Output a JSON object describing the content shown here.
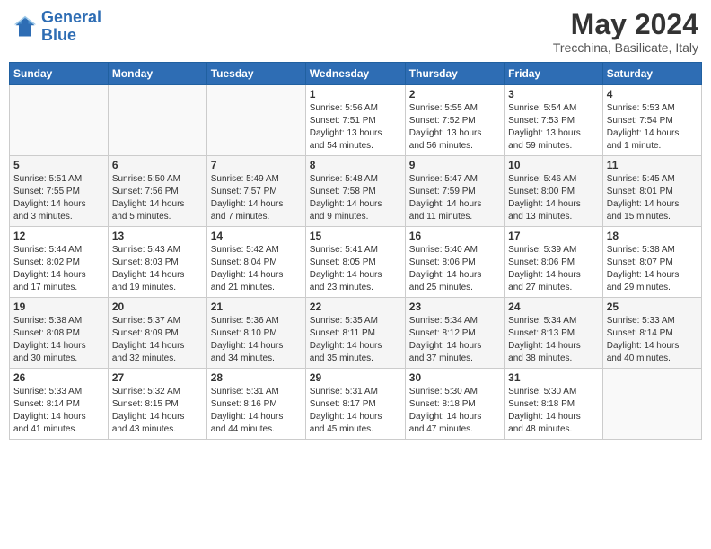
{
  "header": {
    "logo_line1": "General",
    "logo_line2": "Blue",
    "month_year": "May 2024",
    "location": "Trecchina, Basilicate, Italy"
  },
  "days_of_week": [
    "Sunday",
    "Monday",
    "Tuesday",
    "Wednesday",
    "Thursday",
    "Friday",
    "Saturday"
  ],
  "weeks": [
    [
      {
        "day": "",
        "info": ""
      },
      {
        "day": "",
        "info": ""
      },
      {
        "day": "",
        "info": ""
      },
      {
        "day": "1",
        "info": "Sunrise: 5:56 AM\nSunset: 7:51 PM\nDaylight: 13 hours\nand 54 minutes."
      },
      {
        "day": "2",
        "info": "Sunrise: 5:55 AM\nSunset: 7:52 PM\nDaylight: 13 hours\nand 56 minutes."
      },
      {
        "day": "3",
        "info": "Sunrise: 5:54 AM\nSunset: 7:53 PM\nDaylight: 13 hours\nand 59 minutes."
      },
      {
        "day": "4",
        "info": "Sunrise: 5:53 AM\nSunset: 7:54 PM\nDaylight: 14 hours\nand 1 minute."
      }
    ],
    [
      {
        "day": "5",
        "info": "Sunrise: 5:51 AM\nSunset: 7:55 PM\nDaylight: 14 hours\nand 3 minutes."
      },
      {
        "day": "6",
        "info": "Sunrise: 5:50 AM\nSunset: 7:56 PM\nDaylight: 14 hours\nand 5 minutes."
      },
      {
        "day": "7",
        "info": "Sunrise: 5:49 AM\nSunset: 7:57 PM\nDaylight: 14 hours\nand 7 minutes."
      },
      {
        "day": "8",
        "info": "Sunrise: 5:48 AM\nSunset: 7:58 PM\nDaylight: 14 hours\nand 9 minutes."
      },
      {
        "day": "9",
        "info": "Sunrise: 5:47 AM\nSunset: 7:59 PM\nDaylight: 14 hours\nand 11 minutes."
      },
      {
        "day": "10",
        "info": "Sunrise: 5:46 AM\nSunset: 8:00 PM\nDaylight: 14 hours\nand 13 minutes."
      },
      {
        "day": "11",
        "info": "Sunrise: 5:45 AM\nSunset: 8:01 PM\nDaylight: 14 hours\nand 15 minutes."
      }
    ],
    [
      {
        "day": "12",
        "info": "Sunrise: 5:44 AM\nSunset: 8:02 PM\nDaylight: 14 hours\nand 17 minutes."
      },
      {
        "day": "13",
        "info": "Sunrise: 5:43 AM\nSunset: 8:03 PM\nDaylight: 14 hours\nand 19 minutes."
      },
      {
        "day": "14",
        "info": "Sunrise: 5:42 AM\nSunset: 8:04 PM\nDaylight: 14 hours\nand 21 minutes."
      },
      {
        "day": "15",
        "info": "Sunrise: 5:41 AM\nSunset: 8:05 PM\nDaylight: 14 hours\nand 23 minutes."
      },
      {
        "day": "16",
        "info": "Sunrise: 5:40 AM\nSunset: 8:06 PM\nDaylight: 14 hours\nand 25 minutes."
      },
      {
        "day": "17",
        "info": "Sunrise: 5:39 AM\nSunset: 8:06 PM\nDaylight: 14 hours\nand 27 minutes."
      },
      {
        "day": "18",
        "info": "Sunrise: 5:38 AM\nSunset: 8:07 PM\nDaylight: 14 hours\nand 29 minutes."
      }
    ],
    [
      {
        "day": "19",
        "info": "Sunrise: 5:38 AM\nSunset: 8:08 PM\nDaylight: 14 hours\nand 30 minutes."
      },
      {
        "day": "20",
        "info": "Sunrise: 5:37 AM\nSunset: 8:09 PM\nDaylight: 14 hours\nand 32 minutes."
      },
      {
        "day": "21",
        "info": "Sunrise: 5:36 AM\nSunset: 8:10 PM\nDaylight: 14 hours\nand 34 minutes."
      },
      {
        "day": "22",
        "info": "Sunrise: 5:35 AM\nSunset: 8:11 PM\nDaylight: 14 hours\nand 35 minutes."
      },
      {
        "day": "23",
        "info": "Sunrise: 5:34 AM\nSunset: 8:12 PM\nDaylight: 14 hours\nand 37 minutes."
      },
      {
        "day": "24",
        "info": "Sunrise: 5:34 AM\nSunset: 8:13 PM\nDaylight: 14 hours\nand 38 minutes."
      },
      {
        "day": "25",
        "info": "Sunrise: 5:33 AM\nSunset: 8:14 PM\nDaylight: 14 hours\nand 40 minutes."
      }
    ],
    [
      {
        "day": "26",
        "info": "Sunrise: 5:33 AM\nSunset: 8:14 PM\nDaylight: 14 hours\nand 41 minutes."
      },
      {
        "day": "27",
        "info": "Sunrise: 5:32 AM\nSunset: 8:15 PM\nDaylight: 14 hours\nand 43 minutes."
      },
      {
        "day": "28",
        "info": "Sunrise: 5:31 AM\nSunset: 8:16 PM\nDaylight: 14 hours\nand 44 minutes."
      },
      {
        "day": "29",
        "info": "Sunrise: 5:31 AM\nSunset: 8:17 PM\nDaylight: 14 hours\nand 45 minutes."
      },
      {
        "day": "30",
        "info": "Sunrise: 5:30 AM\nSunset: 8:18 PM\nDaylight: 14 hours\nand 47 minutes."
      },
      {
        "day": "31",
        "info": "Sunrise: 5:30 AM\nSunset: 8:18 PM\nDaylight: 14 hours\nand 48 minutes."
      },
      {
        "day": "",
        "info": ""
      }
    ]
  ]
}
